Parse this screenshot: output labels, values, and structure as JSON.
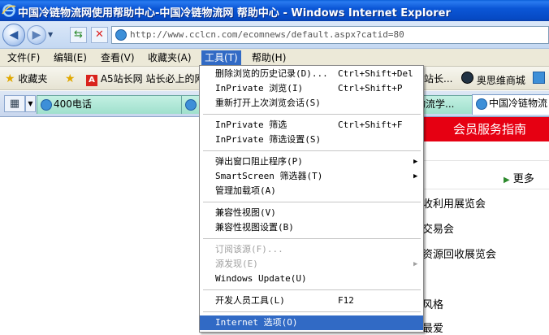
{
  "window": {
    "title": "中国冷链物流网使用帮助中心-中国冷链物流网 帮助中心 - Windows Internet Explorer"
  },
  "address": {
    "url": "http://www.cclcn.com/ecomnews/default.aspx?catid=80"
  },
  "menubar": {
    "file": "文件(F)",
    "edit": "编辑(E)",
    "view": "查看(V)",
    "favorites": "收藏夹(A)",
    "tools": "工具(T)",
    "help": "帮助(H)"
  },
  "favbar": {
    "favorites": "收藏夹",
    "a5": "A5站长网 站长必上的网",
    "partial": "站长...",
    "aosiwei": "奥思维商城"
  },
  "tabs": [
    {
      "label": "400电话"
    },
    {
      "label": "物流学..."
    },
    {
      "label": "中国冷链物流"
    }
  ],
  "content": {
    "member_guide": "会员服务指南",
    "more": "更多",
    "news": [
      "收利用展览会",
      "交易会",
      "资源回收展览会",
      "风格",
      "最爱"
    ]
  },
  "tools_menu": {
    "items": [
      {
        "label": "删除浏览的历史记录(D)...",
        "shortcut": "Ctrl+Shift+Del"
      },
      {
        "label": "InPrivate 浏览(I)",
        "shortcut": "Ctrl+Shift+P"
      },
      {
        "label": "重新打开上次浏览会话(S)",
        "shortcut": ""
      },
      {
        "label": "InPrivate 筛选",
        "shortcut": "Ctrl+Shift+F"
      },
      {
        "label": "InPrivate 筛选设置(S)",
        "shortcut": ""
      },
      {
        "label": "弹出窗口阻止程序(P)",
        "shortcut": ""
      },
      {
        "label": "SmartScreen 筛选器(T)",
        "shortcut": ""
      },
      {
        "label": "管理加载项(A)",
        "shortcut": ""
      },
      {
        "label": "兼容性视图(V)",
        "shortcut": ""
      },
      {
        "label": "兼容性视图设置(B)",
        "shortcut": ""
      },
      {
        "label": "订阅该源(F)...",
        "shortcut": ""
      },
      {
        "label": "源发现(E)",
        "shortcut": ""
      },
      {
        "label": "Windows Update(U)",
        "shortcut": ""
      },
      {
        "label": "开发人员工具(L)",
        "shortcut": "F12"
      },
      {
        "label": "Internet 选项(O)",
        "shortcut": ""
      }
    ]
  }
}
